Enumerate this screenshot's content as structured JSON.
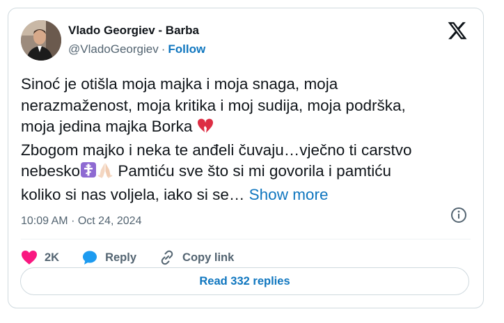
{
  "author": {
    "name": "Vlado Georgiev - Barba",
    "handle": "@VladoGeorgiev",
    "separator": "·",
    "follow_label": "Follow"
  },
  "icons": {
    "logo": "x-logo-icon",
    "info": "info-icon",
    "like": "heart-icon",
    "reply": "reply-bubble-icon",
    "copy": "link-icon"
  },
  "tweet": {
    "line1": "Sinoć je otišla moja majka i moja snaga, moja",
    "line2": "nerazmaženost, moja kritika i moj sudija, moja podrška,",
    "line3": "moja jedina majka Borka",
    "line4": "Zbogom majko i neka te anđeli čuvaju…vječno ti carstvo",
    "line5_a": "nebesko",
    "line5_b": " Pamtiću sve što si mi govorila i pamtiću",
    "line6": "koliko si nas voljela, iako si se…",
    "show_more": "Show more"
  },
  "timestamp": {
    "time": "10:09 AM",
    "separator": "·",
    "date": "Oct 24, 2024"
  },
  "actions": {
    "likes": "2K",
    "reply_label": "Reply",
    "copy_label": "Copy link"
  },
  "read_replies": "Read 332 replies",
  "colors": {
    "accent": "#0f76bf",
    "like": "#f91880",
    "muted": "#536471",
    "border": "#cfd9de"
  }
}
